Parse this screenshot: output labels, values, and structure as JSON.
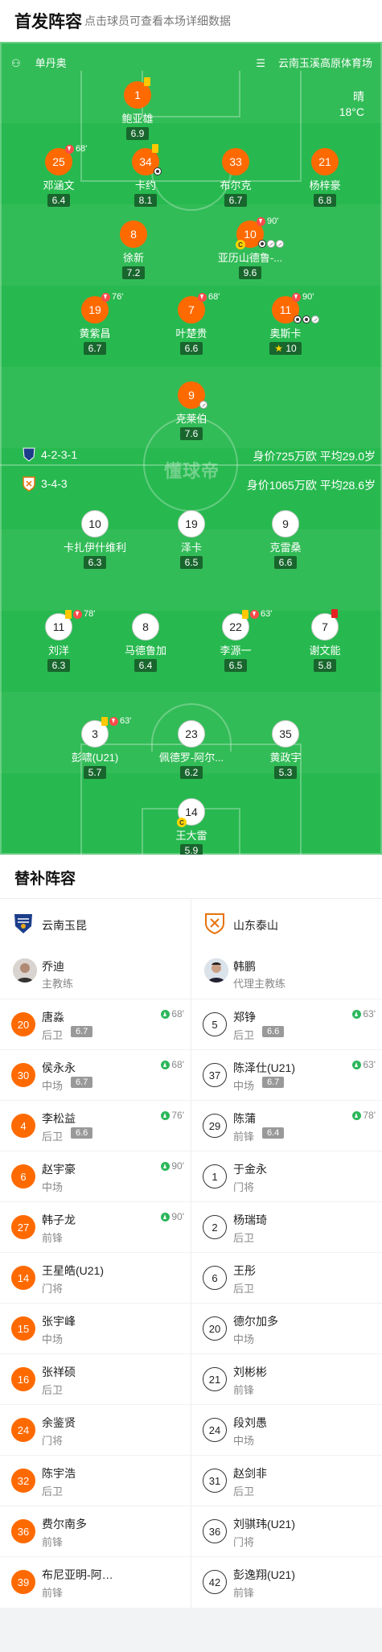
{
  "header": {
    "title": "首发阵容",
    "subtitle": "点击球员可查看本场详细数据"
  },
  "pitch": {
    "referee": "单丹奥",
    "stadium": "云南玉溪高原体育场",
    "weather": "晴",
    "temperature": "18°C",
    "watermark": "懂球帝",
    "home": {
      "formation": "4-2-3-1",
      "value": "身价725万欧",
      "age": "平均29.0岁"
    },
    "away": {
      "formation": "3-4-3",
      "value": "身价1065万欧",
      "age": "平均28.6岁"
    },
    "home_players": [
      {
        "num": "1",
        "name": "鲍亚雄",
        "rating": "6.9",
        "yellow": true
      },
      {
        "num": "25",
        "name": "邓涵文",
        "rating": "6.4",
        "sub": "68'"
      },
      {
        "num": "34",
        "name": "卡约",
        "rating": "8.1",
        "yellow": true,
        "goals": 1
      },
      {
        "num": "33",
        "name": "布尔克",
        "rating": "6.7"
      },
      {
        "num": "21",
        "name": "杨梓豪",
        "rating": "6.8"
      },
      {
        "num": "8",
        "name": "徐新",
        "rating": "7.2"
      },
      {
        "num": "10",
        "name": "亚历山德鲁-...",
        "rating": "9.6",
        "sub": "90'",
        "captain": true,
        "goals": 1,
        "assists": 2
      },
      {
        "num": "19",
        "name": "黄紫昌",
        "rating": "6.7",
        "sub": "76'"
      },
      {
        "num": "7",
        "name": "叶楚贵",
        "rating": "6.6",
        "sub": "68'"
      },
      {
        "num": "11",
        "name": "奥斯卡",
        "rating": "10",
        "sub": "90'",
        "goals": 2,
        "assists": 1,
        "star": true
      },
      {
        "num": "9",
        "name": "克莱伯",
        "rating": "7.6",
        "assists": 1
      }
    ],
    "away_players": [
      {
        "num": "10",
        "name": "卡扎伊什维利",
        "rating": "6.3"
      },
      {
        "num": "19",
        "name": "泽卡",
        "rating": "6.5"
      },
      {
        "num": "9",
        "name": "克雷桑",
        "rating": "6.6"
      },
      {
        "num": "11",
        "name": "刘洋",
        "rating": "6.3",
        "yellow": true,
        "sub": "78'"
      },
      {
        "num": "8",
        "name": "马德鲁加",
        "rating": "6.4"
      },
      {
        "num": "22",
        "name": "李源一",
        "rating": "6.5",
        "yellow": true,
        "sub": "63'"
      },
      {
        "num": "7",
        "name": "谢文能",
        "rating": "5.8",
        "red": true
      },
      {
        "num": "3",
        "name": "彭啸(U21)",
        "rating": "5.7",
        "yellow": true,
        "sub": "63'"
      },
      {
        "num": "23",
        "name": "佩德罗-阿尔...",
        "rating": "6.2"
      },
      {
        "num": "35",
        "name": "黄政宇",
        "rating": "5.3"
      },
      {
        "num": "14",
        "name": "王大雷",
        "rating": "5.9",
        "captain": true
      }
    ]
  },
  "subs": {
    "title": "替补阵容",
    "home": {
      "team": "云南玉昆",
      "coach": {
        "name": "乔迪",
        "role": "主教练"
      },
      "players": [
        {
          "num": "20",
          "name": "唐淼",
          "pos": "后卫",
          "rating": "6.7",
          "in": "68'"
        },
        {
          "num": "30",
          "name": "侯永永",
          "pos": "中场",
          "rating": "6.7",
          "in": "68'"
        },
        {
          "num": "4",
          "name": "李松益",
          "pos": "后卫",
          "rating": "6.6",
          "in": "76'"
        },
        {
          "num": "6",
          "name": "赵宇豪",
          "pos": "中场",
          "in": "90'"
        },
        {
          "num": "27",
          "name": "韩子龙",
          "pos": "前锋",
          "in": "90'"
        },
        {
          "num": "14",
          "name": "王星皓(U21)",
          "pos": "门将"
        },
        {
          "num": "15",
          "name": "张宇峰",
          "pos": "中场"
        },
        {
          "num": "16",
          "name": "张祥硕",
          "pos": "后卫"
        },
        {
          "num": "24",
          "name": "余鉴贤",
          "pos": "门将"
        },
        {
          "num": "32",
          "name": "陈宇浩",
          "pos": "后卫"
        },
        {
          "num": "36",
          "name": "费尔南多",
          "pos": "前锋"
        },
        {
          "num": "39",
          "name": "布尼亚明-阿…",
          "pos": "前锋"
        }
      ]
    },
    "away": {
      "team": "山东泰山",
      "coach": {
        "name": "韩鹏",
        "role": "代理主教练"
      },
      "players": [
        {
          "num": "5",
          "name": "郑铮",
          "pos": "后卫",
          "rating": "6.6",
          "in": "63'"
        },
        {
          "num": "37",
          "name": "陈泽仕(U21)",
          "pos": "中场",
          "rating": "6.7",
          "in": "63'"
        },
        {
          "num": "29",
          "name": "陈蒲",
          "pos": "前锋",
          "rating": "6.4",
          "in": "78'"
        },
        {
          "num": "1",
          "name": "于金永",
          "pos": "门将"
        },
        {
          "num": "2",
          "name": "杨瑞琦",
          "pos": "后卫"
        },
        {
          "num": "6",
          "name": "王彤",
          "pos": "后卫"
        },
        {
          "num": "20",
          "name": "德尔加多",
          "pos": "中场"
        },
        {
          "num": "21",
          "name": "刘彬彬",
          "pos": "前锋"
        },
        {
          "num": "24",
          "name": "段刘愚",
          "pos": "中场"
        },
        {
          "num": "31",
          "name": "赵剑非",
          "pos": "后卫"
        },
        {
          "num": "36",
          "name": "刘骐玮(U21)",
          "pos": "门将"
        },
        {
          "num": "42",
          "name": "彭逸翔(U21)",
          "pos": "前锋"
        }
      ]
    }
  },
  "colors": {
    "home": "#ff6a00",
    "pitch": "#27b94f",
    "rating_bg": "#18662d"
  }
}
